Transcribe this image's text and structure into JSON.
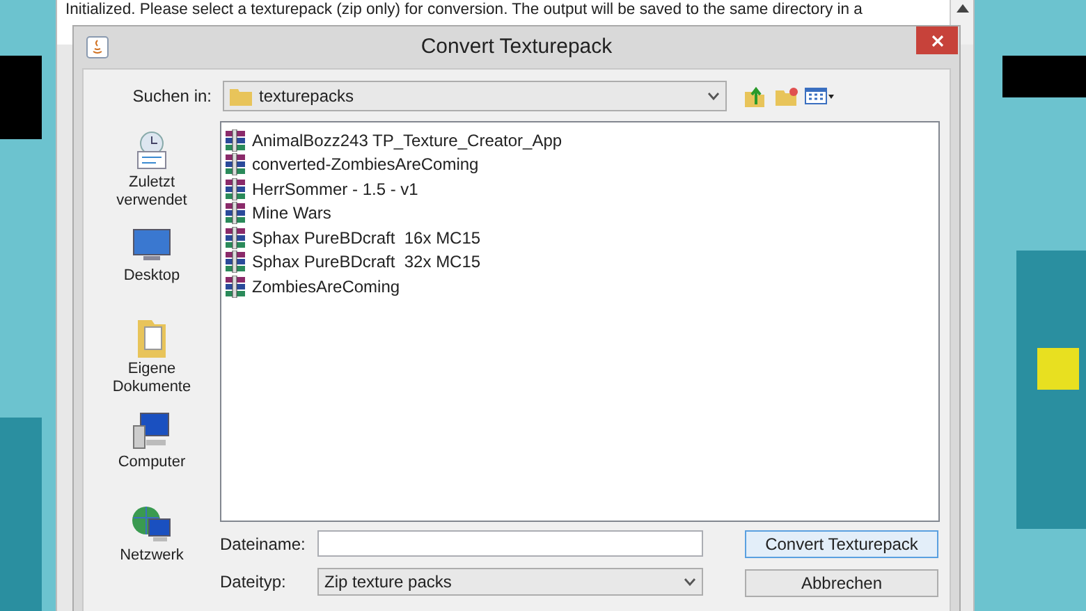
{
  "background_window": {
    "log_text": "Initialized. Please select a texturepack (zip only) for conversion. The output will be saved to the same directory in a"
  },
  "dialog": {
    "title": "Convert Texturepack",
    "look_in": {
      "label": "Suchen in:",
      "value": "texturepacks"
    },
    "places": [
      {
        "label": "Zuletzt verwendet",
        "kind": "recent"
      },
      {
        "label": "Desktop",
        "kind": "desktop"
      },
      {
        "label": "Eigene Dokumente",
        "kind": "documents"
      },
      {
        "label": "Computer",
        "kind": "computer"
      },
      {
        "label": "Netzwerk",
        "kind": "network"
      }
    ],
    "files": [
      {
        "name": "AnimalBozz243 TP_Texture_Creator_App"
      },
      {
        "name": "converted-ZombiesAreComing"
      },
      {
        "name": "HerrSommer - 1.5 - v1"
      },
      {
        "name": "Mine Wars"
      },
      {
        "name": "Sphax PureBDcraft  16x MC15"
      },
      {
        "name": "Sphax PureBDcraft  32x MC15"
      },
      {
        "name": "ZombiesAreComing"
      }
    ],
    "file_name": {
      "label": "Dateiname:"
    },
    "file_type": {
      "label": "Dateityp:",
      "value": "Zip texture packs"
    },
    "buttons": [
      {
        "label": "Convert Texturepack",
        "default": true
      },
      {
        "label": "Abbrechen",
        "default": false
      }
    ]
  }
}
